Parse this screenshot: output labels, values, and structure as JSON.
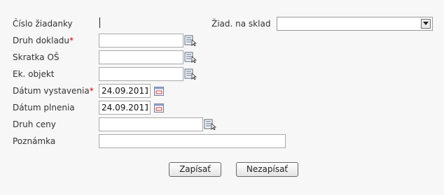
{
  "form": {
    "cislo_ziadanky": {
      "label": "Číslo žiadanky",
      "value": ""
    },
    "ziad_na_sklad": {
      "label": "Žiad. na sklad",
      "selected": ""
    },
    "druh_dokladu": {
      "label": "Druh dokladu",
      "required_mark": "*",
      "value": ""
    },
    "skratka_os": {
      "label": "Skratka OŠ",
      "value": ""
    },
    "ek_objekt": {
      "label": "Ek. objekt",
      "value": ""
    },
    "datum_vystavenia": {
      "label": "Dátum vystavenia",
      "required_mark": "*",
      "value": "24.09.2011"
    },
    "datum_plnenia": {
      "label": "Dátum plnenia",
      "value": "24.09.2011"
    },
    "druh_ceny": {
      "label": "Druh ceny",
      "value": ""
    },
    "poznamka": {
      "label": "Poznámka",
      "value": ""
    }
  },
  "buttons": {
    "save": "Zapísať",
    "cancel": "Nezapísať"
  },
  "icons": {
    "lookup": "lookup-list-icon",
    "calendar": "calendar-icon",
    "dropdown": "dropdown-arrow-icon"
  },
  "colors": {
    "background": "#f7f7f7",
    "label_text": "#333333",
    "required_mark": "#cc0000",
    "field_border": "#aaaaaa",
    "calendar_accent": "#d03030"
  }
}
